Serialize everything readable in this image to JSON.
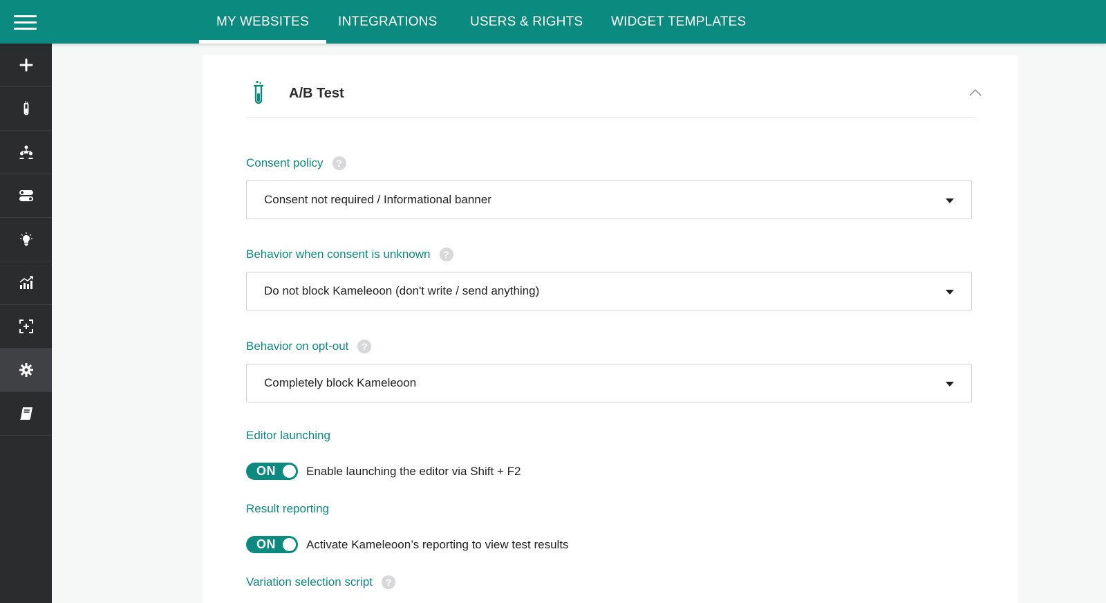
{
  "topbar": {
    "tabs": [
      {
        "label": "MY WEBSITES",
        "active": true
      },
      {
        "label": "INTEGRATIONS",
        "active": false
      },
      {
        "label": "USERS & RIGHTS",
        "active": false
      },
      {
        "label": "WIDGET TEMPLATES",
        "active": false
      }
    ]
  },
  "sidebar": {
    "items": [
      {
        "icon": "plus-icon"
      },
      {
        "icon": "test-tube-icon"
      },
      {
        "icon": "segments-icon"
      },
      {
        "icon": "toggles-icon"
      },
      {
        "icon": "lightbulb-icon"
      },
      {
        "icon": "chart-icon"
      },
      {
        "icon": "target-icon"
      },
      {
        "icon": "gear-icon",
        "active": true
      },
      {
        "icon": "book-icon"
      }
    ]
  },
  "card": {
    "title": "A/B Test",
    "icon": "test-tube-icon"
  },
  "fields": {
    "consent_policy": {
      "label": "Consent policy",
      "help": "?",
      "value": "Consent not required / Informational banner"
    },
    "behavior_unknown": {
      "label": "Behavior when consent is unknown",
      "help": "?",
      "value": "Do not block Kameleoon (don't write / send anything)"
    },
    "behavior_optout": {
      "label": "Behavior on opt-out",
      "help": "?",
      "value": "Completely block Kameleoon"
    },
    "editor_launching": {
      "label": "Editor launching",
      "toggle": "ON",
      "description": "Enable launching the editor via Shift + F2"
    },
    "result_reporting": {
      "label": "Result reporting",
      "toggle": "ON",
      "description": "Activate Kameleoon’s reporting to view test results"
    },
    "variation_script": {
      "label": "Variation selection script",
      "help": "?"
    }
  },
  "colors": {
    "accent": "#0b8a7f",
    "sidebar": "#2b2c2e"
  }
}
